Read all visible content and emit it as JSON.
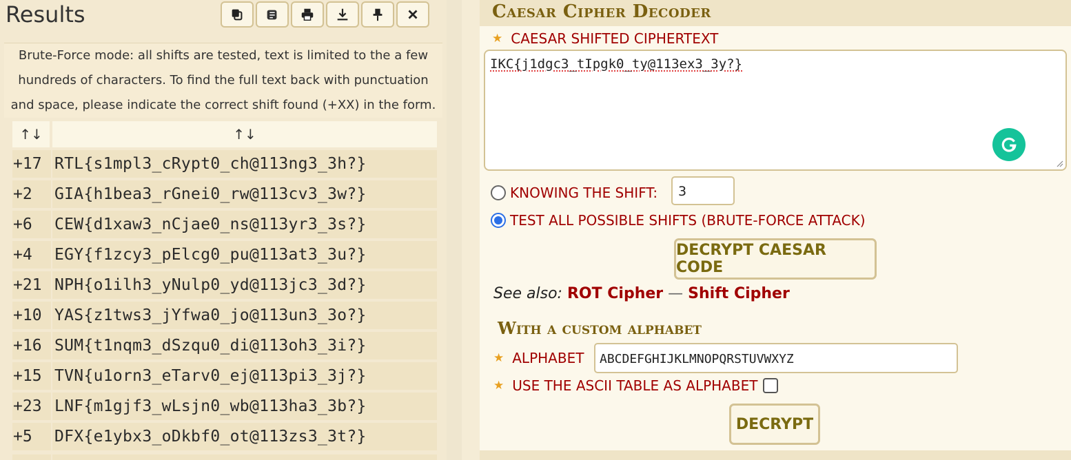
{
  "results": {
    "title": "Results",
    "toolbar": {
      "copy": "copy-icon",
      "settings": "edit-icon",
      "print": "print-icon",
      "download": "download-icon",
      "pin": "pin-icon",
      "close": "close-icon"
    },
    "description": [
      "Brute-Force mode: all shifts are tested, text is limited to the a few",
      "hundreds of characters. To find the full text back with punctuation",
      "and space, please indicate the correct shift found (+XX) in the form."
    ],
    "columns": [
      "↑↓",
      "↑↓"
    ],
    "rows": [
      {
        "shift": "+17",
        "text": "RTL{s1mpl3_cRypt0_ch@113ng3_3h?}"
      },
      {
        "shift": "+2",
        "text": "GIA{h1bea3_rGnei0_rw@113cv3_3w?}"
      },
      {
        "shift": "+6",
        "text": "CEW{d1xaw3_nCjae0_ns@113yr3_3s?}"
      },
      {
        "shift": "+4",
        "text": "EGY{f1zcy3_pElcg0_pu@113at3_3u?}"
      },
      {
        "shift": "+21",
        "text": "NPH{o1ilh3_yNulp0_yd@113jc3_3d?}"
      },
      {
        "shift": "+10",
        "text": "YAS{z1tws3_jYfwa0_jo@113un3_3o?}"
      },
      {
        "shift": "+16",
        "text": "SUM{t1nqm3_dSzqu0_di@113oh3_3i?}"
      },
      {
        "shift": "+15",
        "text": "TVN{u1orn3_eTarv0_ej@113pi3_3j?}"
      },
      {
        "shift": "+23",
        "text": "LNF{m1gjf3_wLsjn0_wb@113ha3_3b?}"
      },
      {
        "shift": "+5",
        "text": "DFX{e1ybx3_oDkbf0_ot@113zs3_3t?}"
      }
    ]
  },
  "tool": {
    "title": "Caesar Cipher Decoder",
    "ciphertext_label": "CAESAR SHIFTED CIPHERTEXT",
    "ciphertext_value": "IKC{j1dgc3_tIpgk0_ty@113ex3_3y?}",
    "knowing_shift_label": "KNOWING THE SHIFT:",
    "shift_value": "3",
    "brute_force_label": "TEST ALL POSSIBLE SHIFTS (BRUTE-FORCE ATTACK)",
    "selected_mode": "brute-force",
    "decrypt_caesar_button": "DECRYPT CAESAR CODE",
    "see_also_label": "See also:",
    "see_also_links": [
      "ROT Cipher",
      "Shift Cipher"
    ],
    "see_also_sep": "—",
    "custom_alphabet_title": "With a custom alphabet",
    "alphabet_label": "ALPHABET",
    "alphabet_value": "ABCDEFGHIJKLMNOPQRSTUVWXYZ",
    "ascii_label": "USE THE ASCII TABLE AS ALPHABET",
    "ascii_checked": false,
    "decrypt_button": "DECRYPT"
  },
  "colors": {
    "accent_red": "#a00000",
    "accent_gold": "#7a6010",
    "grammarly_green": "#15c39a",
    "radio_blue": "#2b6fe6"
  }
}
